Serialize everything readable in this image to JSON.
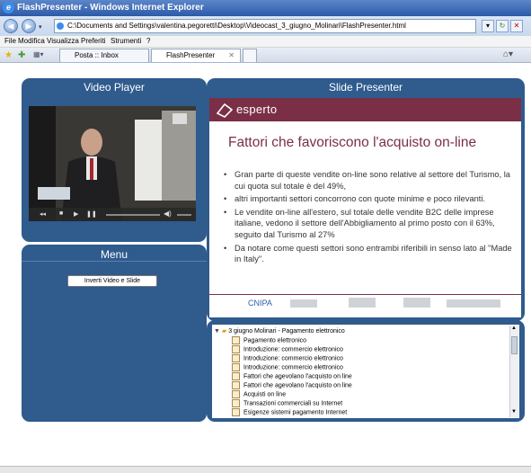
{
  "window": {
    "title": "FlashPresenter - Windows Internet Explorer"
  },
  "address": {
    "url": "C:\\Documents and Settings\\valentina.pegoretti\\Desktop\\Videocast_3_giugno_Molinari\\FlashPresenter.html"
  },
  "menu": [
    "File",
    "Modifica",
    "Visualizza",
    "Preferiti",
    "Strumenti",
    "?"
  ],
  "tabs": [
    {
      "label": "Posta :: Inbox"
    },
    {
      "label": "FlashPresenter"
    }
  ],
  "video_panel": {
    "title": "Video Player"
  },
  "slide_panel": {
    "title": "Slide Presenter"
  },
  "menu_panel": {
    "title": "Menu",
    "invert_button": "Inverti Video e Slide"
  },
  "slide": {
    "logo_text": "esperto",
    "title": "Fattori che favoriscono l'acquisto on-line",
    "bullets": [
      "Gran parte di queste vendite on-line sono relative al settore del Turismo, la cui quota sul totale è del 49%,",
      "altri importanti settori concorrono con quote minime e poco rilevanti.",
      "Le vendite on-line all'estero, sul totale delle  vendite B2C delle imprese italiane, vedono il settore dell'Abbigliamento al primo posto con il 63%, seguito dal Turismo al 27%",
      "Da notare come questi  settori sono entrambi riferibili in senso lato al \"Made in Italy\"."
    ],
    "footer_logo": "CNIPA"
  },
  "tree": {
    "root": "3 giugno Molinari - Pagamento elettronico",
    "items": [
      "Pagamento elettronico",
      "Introduzione: commercio elettronico",
      "Introduzione: commercio elettronico",
      "Introduzione: commercio elettronico",
      "Fattori che agevolano l'acquisto on line",
      "Fattori che agevolano l'acquisto on line",
      "Acquisti on line",
      "Transazioni commerciali su Internet",
      "Esigenze sistemi pagamento Internet"
    ]
  },
  "colors": {
    "panel": "#2f5b8d",
    "slide_accent": "#7b2f47"
  }
}
